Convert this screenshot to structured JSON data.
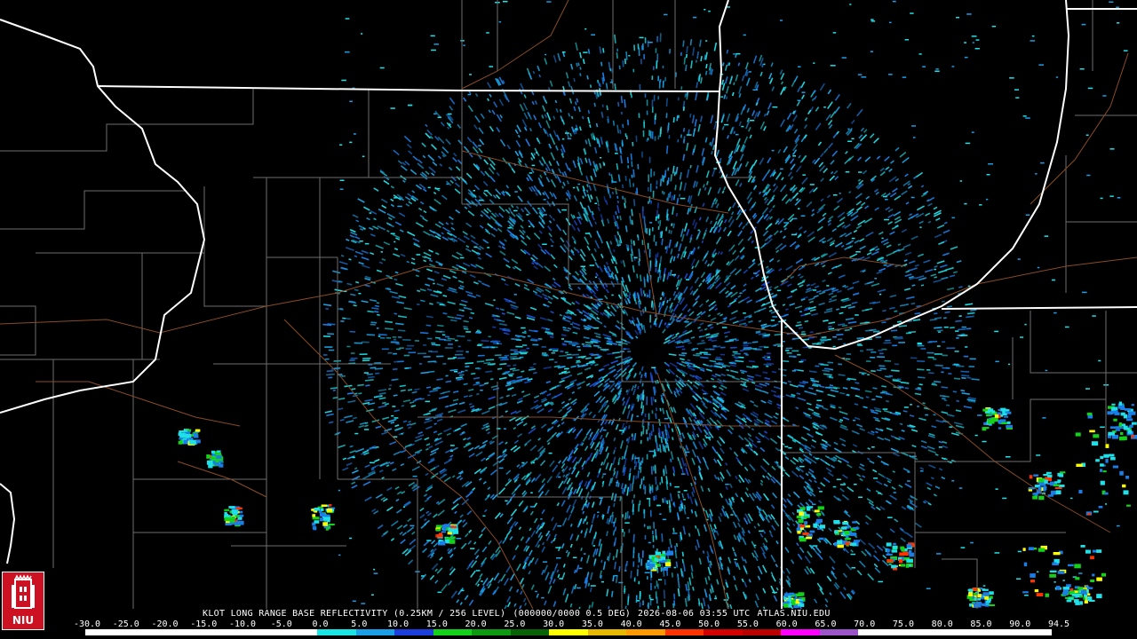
{
  "header": {
    "product": "KLOT LONG RANGE BASE REFLECTIVITY (0.25KM / 256 LEVEL)",
    "info": "(000000/0000 0.5 DEG)",
    "timestamp": "2026-08-06 03:55 UTC",
    "source": "ATLAS.NIU.EDU"
  },
  "legend": {
    "ticks": [
      "-30.0",
      "-25.0",
      "-20.0",
      "-15.0",
      "-10.0",
      "-5.0",
      "0.0",
      "5.0",
      "10.0",
      "15.0",
      "20.0",
      "25.0",
      "30.0",
      "35.0",
      "40.0",
      "45.0",
      "50.0",
      "55.0",
      "60.0",
      "65.0",
      "70.0",
      "75.0",
      "80.0",
      "85.0",
      "90.0",
      "94.5"
    ],
    "colors": [
      "#ffffff",
      "#ffffff",
      "#ffffff",
      "#ffffff",
      "#ffffff",
      "#ffffff",
      "#19e3e3",
      "#1a9ee6",
      "#1a3fdc",
      "#13d219",
      "#0c9a10",
      "#076306",
      "#ffff00",
      "#e6b800",
      "#ff9900",
      "#ff3300",
      "#d40000",
      "#bb0000",
      "#ff00ff",
      "#9b55c9",
      "#ffffff",
      "#ffffff",
      "#ffffff",
      "#ffffff",
      "#ffffff"
    ]
  },
  "logo": {
    "text": "NIU"
  }
}
